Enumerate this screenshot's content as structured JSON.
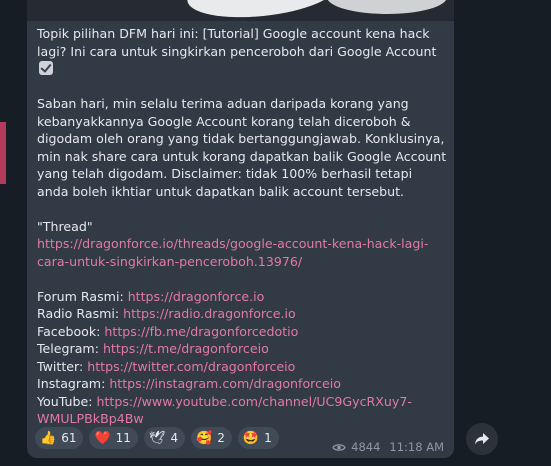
{
  "message": {
    "intro": "Topik pilihan DFM hari ini: [Tutorial] Google account kena hack lagi? Ini cara untuk singkirkan penceroboh dari Google Account",
    "body": "Saban hari, min selalu terima aduan daripada korang yang kebanyakkannya Google Account korang telah diceroboh & digodam oleh orang yang tidak bertanggungjawab. Konklusinya, min nak share cara untuk korang dapatkan balik Google Account yang telah digodam. Disclaimer: tidak 100% berhasil tetapi anda boleh ikhtiar untuk dapatkan balik account tersebut.",
    "thread_label": "\"Thread\"",
    "thread_link": "https://dragonforce.io/threads/google-account-kena-hack-lagi-cara-untuk-singkirkan-penceroboh.13976/",
    "links": [
      {
        "label": "Forum Rasmi: ",
        "url": "https://dragonforce.io"
      },
      {
        "label": "Radio Rasmi: ",
        "url": "https://radio.dragonforce.io"
      },
      {
        "label": "Facebook: ",
        "url": "https://fb.me/dragonforcedotio"
      },
      {
        "label": "Telegram: ",
        "url": "https://t.me/dragonforceio"
      },
      {
        "label": "Twitter: ",
        "url": "https://twitter.com/dragonforceio"
      },
      {
        "label": "Instagram: ",
        "url": "https://instagram.com/dragonforceio"
      },
      {
        "label": "YouTube: ",
        "url": "https://www.youtube.com/channel/UC9GycRXuy7-WMULPBkBp4Bw"
      }
    ]
  },
  "reactions": [
    {
      "emoji": "👍",
      "count": "61"
    },
    {
      "emoji": "❤️",
      "count": "11"
    },
    {
      "emoji": "🕊",
      "count": "4"
    },
    {
      "emoji": "🥰",
      "count": "2"
    },
    {
      "emoji": "🤩",
      "count": "1"
    }
  ],
  "meta": {
    "views": "4844",
    "time": "11:18 AM"
  },
  "colors": {
    "bubble": "#323a45",
    "link": "#e37aa4",
    "background": "#171d24"
  }
}
